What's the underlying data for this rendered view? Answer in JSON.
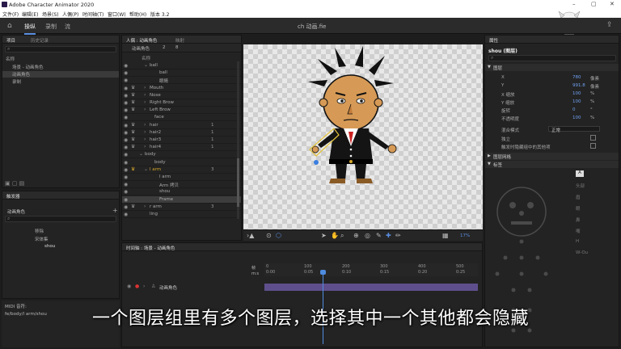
{
  "window": {
    "title": "Adobe Character Animator 2020",
    "controls": [
      "–",
      "▢",
      "✕"
    ]
  },
  "menu": [
    "文件(F)",
    "编辑(E)",
    "场景(S)",
    "人偶(P)",
    "时间轴(T)",
    "窗口(W)",
    "帮助(H)",
    "版本 3.2"
  ],
  "modes": {
    "record": "操纵",
    "rig": "录制",
    "stream": "流"
  },
  "project_name": "ch 动画.fie",
  "project_panel": {
    "tabs": [
      "项目",
      "历史记录"
    ],
    "name_header": "名称",
    "items": [
      {
        "label": "场景 - 动画角色"
      },
      {
        "label": "动画角色",
        "selected": true
      },
      {
        "label": "录制"
      }
    ]
  },
  "triggers_panel": {
    "tab": "触发器",
    "puppet_label": "动画角色",
    "items": [
      "移除",
      "宋体集",
      "shou"
    ]
  },
  "midi": {
    "label": "MIDI 音符:",
    "path": "fe/body/l arm/shou"
  },
  "puppet_panel": {
    "tabs": [
      "人偶 : 动画角色",
      "映射"
    ],
    "title": "动画角色",
    "counts": [
      "2",
      "8"
    ],
    "col_name": "名称",
    "layers": [
      {
        "name": "ball",
        "indent": 2,
        "arrow": "open"
      },
      {
        "name": "ball",
        "indent": 4
      },
      {
        "name": "眼睛",
        "indent": 4
      },
      {
        "name": "Mouth",
        "indent": 2,
        "arrow": "closed",
        "crown": true
      },
      {
        "name": "Nose",
        "indent": 2,
        "arrow": "closed",
        "crown": true
      },
      {
        "name": "Right Brow",
        "indent": 2,
        "arrow": "closed",
        "crown": true
      },
      {
        "name": "Left Brow",
        "indent": 2,
        "arrow": "closed",
        "crown": true
      },
      {
        "name": "face",
        "indent": 3
      },
      {
        "name": "hair",
        "indent": 2,
        "arrow": "closed",
        "crown": true,
        "num": "1"
      },
      {
        "name": "hair2",
        "indent": 2,
        "arrow": "closed",
        "crown": true,
        "num": "1"
      },
      {
        "name": "hair3",
        "indent": 2,
        "arrow": "closed",
        "crown": true,
        "num": "1"
      },
      {
        "name": "hair4",
        "indent": 2,
        "arrow": "closed",
        "crown": true,
        "num": "1"
      },
      {
        "name": "body",
        "indent": 1,
        "arrow": "open"
      },
      {
        "name": "body",
        "indent": 3
      },
      {
        "name": "l arm",
        "indent": 2,
        "arrow": "open",
        "crown": true,
        "gold": true,
        "num": "3"
      },
      {
        "name": "l arm",
        "indent": 4
      },
      {
        "name": "Arm 拷贝",
        "indent": 4
      },
      {
        "name": "shou",
        "indent": 4
      },
      {
        "name": "Frame",
        "indent": 4,
        "hl": true
      },
      {
        "name": "r arm",
        "indent": 2,
        "arrow": "closed",
        "crown": true,
        "num": "3"
      },
      {
        "name": "ling",
        "indent": 2
      }
    ]
  },
  "stage": {
    "zoom": "17%"
  },
  "timeline": {
    "title": "时间轴 : 场景 - 动画角色",
    "time_label": "m:s",
    "frame_label": "帧",
    "ticks": [
      "0:00",
      "0:05",
      "0:10",
      "0:15",
      "0:20",
      "0:25"
    ],
    "frames": [
      "0",
      "100",
      "200",
      "300",
      "400",
      "500"
    ],
    "track_name": "动画角色"
  },
  "properties": {
    "tab": "属性",
    "layer_title": "shou (图层)",
    "section_layer": "图层",
    "rows": [
      {
        "label": "X",
        "value": "780",
        "unit": "像素"
      },
      {
        "label": "Y",
        "value": "991.8",
        "unit": "像素"
      },
      {
        "label": "X 缩放",
        "value": "100",
        "unit": "%"
      },
      {
        "label": "Y 缩放",
        "value": "100",
        "unit": "%"
      },
      {
        "label": "旋转",
        "value": "0",
        "unit": "°"
      },
      {
        "label": "不透明度",
        "value": "100",
        "unit": "%"
      }
    ],
    "blend_label": "混合模式",
    "blend_value": "正常",
    "isolate_label": "独立",
    "hide_label": "触发时隐藏组中的其他项",
    "section_mesh": "图层网格",
    "section_tag": "标签",
    "tag_button": "A",
    "tag_list": [
      "头部",
      "眉",
      "眼",
      "鼻",
      "嘴",
      "H",
      "W-Ou"
    ]
  },
  "subtitle": "一个图层组里有多个图层，选择其中一个其他都会隐藏",
  "colors": {
    "accent": "#5a8de0",
    "track": "#5e4f8c",
    "gold": "#d4a62a"
  }
}
